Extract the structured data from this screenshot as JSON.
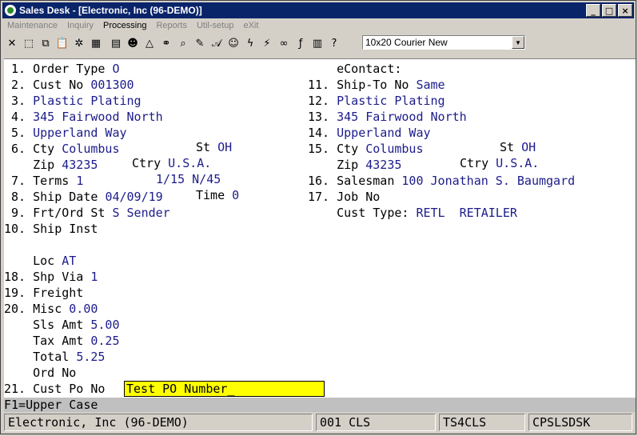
{
  "window": {
    "title": "Sales Desk - [Electronic, Inc (96-DEMO)]"
  },
  "menu": [
    "Maintenance",
    "Inquiry",
    "Processing",
    "Reports",
    "Util-setup",
    "eXit"
  ],
  "toolbar": {
    "font_value": "10x20 Courier New"
  },
  "form": {
    "left": [
      {
        "label": " 1. Order Type",
        "value": "O"
      },
      {
        "label": " 2. Cust No",
        "value": "001300"
      },
      {
        "label": " 3.",
        "value": "Plastic Plating"
      },
      {
        "label": " 4.",
        "value": "345 Fairwood North"
      },
      {
        "label": " 5.",
        "value": "Upperland Way"
      },
      {
        "label": " 6. Cty",
        "value": "Columbus"
      },
      {
        "label": "    Zip",
        "value": "43235"
      },
      {
        "label": " 7. Terms",
        "value": "1"
      },
      {
        "label": " 8. Ship Date",
        "value": "04/09/19"
      },
      {
        "label": " 9. Frt/Ord St",
        "value": "S Sender"
      },
      {
        "label": "10. Ship Inst",
        "value": ""
      }
    ],
    "state_label": "St",
    "state_value": "OH",
    "ctry_label": "Ctry",
    "ctry_value": "U.S.A.",
    "terms_desc": "1/15 N/45",
    "time_label": "Time",
    "time_value": "0",
    "right": [
      {
        "label": "    eContact:",
        "value": ""
      },
      {
        "label": "11. Ship-To No",
        "value": "Same"
      },
      {
        "label": "12.",
        "value": "Plastic Plating"
      },
      {
        "label": "13.",
        "value": "345 Fairwood North"
      },
      {
        "label": "14.",
        "value": "Upperland Way"
      },
      {
        "label": "15. Cty",
        "value": "Columbus"
      },
      {
        "label": "    Zip",
        "value": "43235"
      },
      {
        "label": "16. Salesman",
        "value": "100 Jonathan S. Baumgard"
      },
      {
        "label": "17. Job No",
        "value": ""
      },
      {
        "label": "    Cust Type:",
        "value": "RETL  RETAILER"
      }
    ],
    "r_state_value": "OH",
    "r_ctry_value": "U.S.A.",
    "bottom": [
      {
        "label": "    Loc",
        "value": "AT"
      },
      {
        "label": "18. Shp Via",
        "value": "1"
      },
      {
        "label": "19. Freight",
        "value": ""
      },
      {
        "label": "20. Misc",
        "value": "0.00"
      },
      {
        "label": "    Sls Amt",
        "value": "5.00"
      },
      {
        "label": "    Tax Amt",
        "value": "0.25"
      },
      {
        "label": "    Total",
        "value": "5.25"
      },
      {
        "label": "    Ord No",
        "value": ""
      }
    ],
    "po_label": "21. Cust Po No",
    "po_value": "Test PO Number_"
  },
  "help": "F1=Upper Case",
  "status": {
    "company": "Electronic, Inc (96-DEMO)",
    "user": "001 CLS",
    "terminal": "TS4CLS",
    "program": "CPSLSDSK"
  }
}
